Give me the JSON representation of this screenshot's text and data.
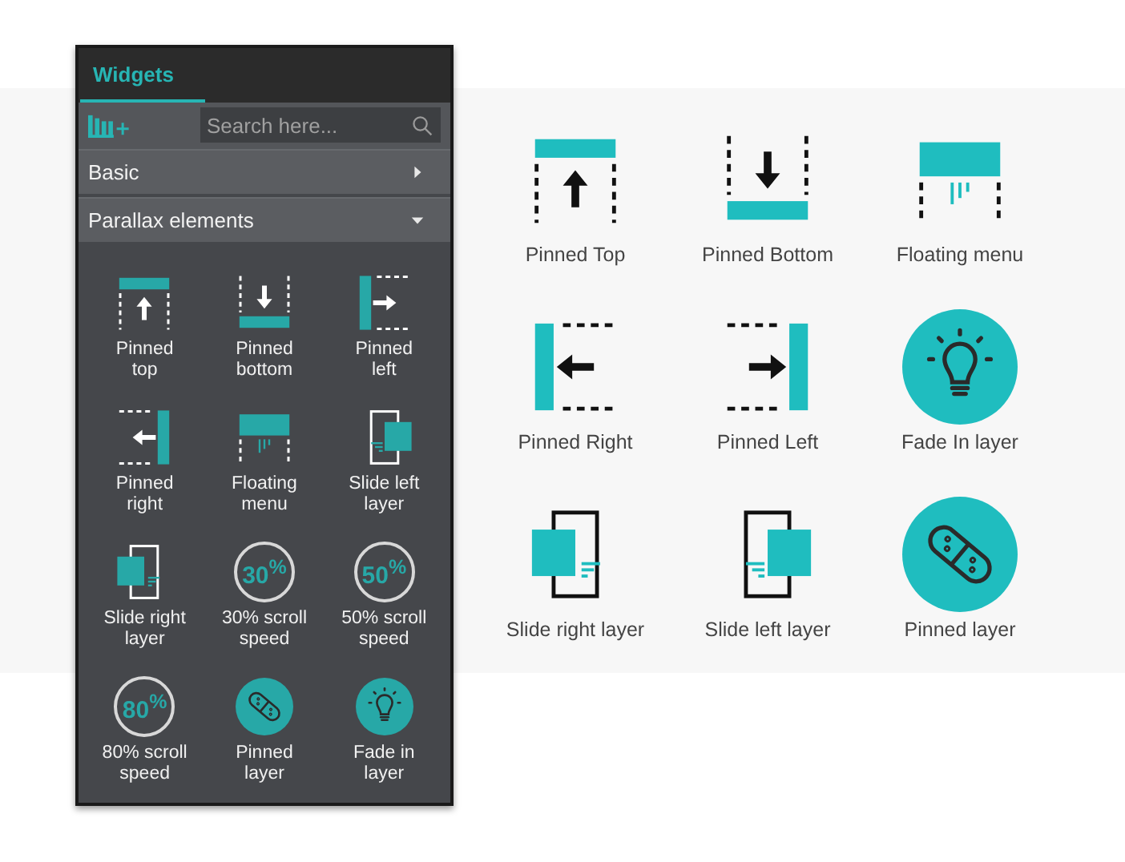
{
  "panel": {
    "tabs": [
      {
        "label": "Widgets",
        "selected": true
      }
    ],
    "search": {
      "placeholder": "Search here..."
    },
    "sections": [
      {
        "label": "Basic",
        "expanded": false
      },
      {
        "label": "Parallax elements",
        "expanded": true
      }
    ],
    "widgets": [
      {
        "label": "Pinned\ntop",
        "icon": {
          "kind": "pinned-top"
        }
      },
      {
        "label": "Pinned\nbottom",
        "icon": {
          "kind": "pinned-bottom"
        }
      },
      {
        "label": "Pinned\nleft",
        "icon": {
          "kind": "bar-left-arrow-right"
        }
      },
      {
        "label": "Pinned\nright",
        "icon": {
          "kind": "bar-right-arrow-left"
        }
      },
      {
        "label": "Floating\nmenu",
        "icon": {
          "kind": "floating-menu"
        }
      },
      {
        "label": "Slide left\nlayer",
        "icon": {
          "kind": "slide-square-right"
        }
      },
      {
        "label": "Slide right\nlayer",
        "icon": {
          "kind": "slide-square-left"
        }
      },
      {
        "label": "30% scroll\nspeed",
        "icon": {
          "kind": "speed",
          "text": "30$^{%}$"
        }
      },
      {
        "label": "50% scroll\nspeed",
        "icon": {
          "kind": "speed",
          "text": "50$^{%}$"
        }
      },
      {
        "label": "80% scroll\nspeed",
        "icon": {
          "kind": "speed",
          "text": "80$^{%}$"
        }
      },
      {
        "label": "Pinned\nlayer",
        "icon": {
          "kind": "bandage"
        }
      },
      {
        "label": "Fade in\nlayer",
        "icon": {
          "kind": "bulb"
        }
      }
    ]
  },
  "gallery": [
    {
      "label": "Pinned Top",
      "icon": {
        "kind": "pinned-top"
      }
    },
    {
      "label": "Pinned Bottom",
      "icon": {
        "kind": "pinned-bottom"
      }
    },
    {
      "label": "Floating menu",
      "icon": {
        "kind": "floating-menu"
      }
    },
    {
      "label": "Pinned Right",
      "icon": {
        "kind": "bar-left-arrow-left"
      }
    },
    {
      "label": "Pinned Left",
      "icon": {
        "kind": "bar-right-arrow-right"
      }
    },
    {
      "label": "Fade In layer",
      "icon": {
        "kind": "bulb"
      }
    },
    {
      "label": "Slide right layer",
      "icon": {
        "kind": "slide-square-left"
      }
    },
    {
      "label": "Slide left layer",
      "icon": {
        "kind": "slide-square-right"
      }
    },
    {
      "label": "Pinned layer",
      "icon": {
        "kind": "bandage"
      }
    }
  ]
}
